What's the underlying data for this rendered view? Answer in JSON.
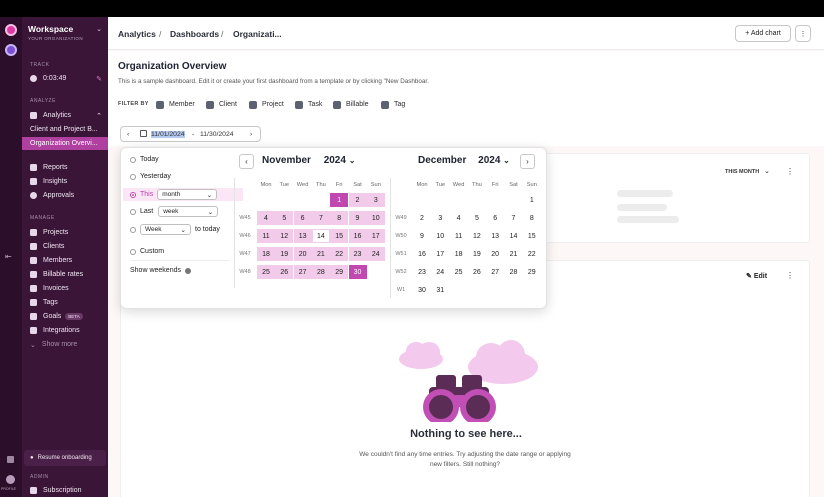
{
  "workspace": {
    "name": "Workspace",
    "subtitle": "YOUR ORGANIZATION",
    "rail_label": "PROFILE"
  },
  "sidebar": {
    "track_label": "TRACK",
    "timer": "0:03:49",
    "analyze_label": "ANALYZE",
    "analytics": "Analytics",
    "analytics_items": [
      "Client and Project B...",
      "Organization Overvi..."
    ],
    "analyze_items": [
      "Reports",
      "Insights",
      "Approvals"
    ],
    "manage_label": "MANAGE",
    "manage_items": [
      "Projects",
      "Clients",
      "Members",
      "Billable rates",
      "Invoices",
      "Tags",
      "Goals",
      "Integrations",
      "Show more"
    ],
    "goals_badge": "BETA",
    "resume": "Resume onboarding",
    "admin_label": "ADMIN",
    "subscription": "Subscription"
  },
  "header": {
    "breadcrumb": [
      "Analytics",
      "Dashboards",
      "Organizati..."
    ],
    "add_chart": "+ Add chart",
    "more": "⋮"
  },
  "page": {
    "title": "Organization Overview",
    "description": "This is a sample dashboard. Edit it or create your first dashboard from a template or by clicking \"New Dashboar.",
    "filter_by": "FILTER BY",
    "filters": [
      "Member",
      "Client",
      "Project",
      "Task",
      "Billable",
      "Tag"
    ]
  },
  "daterange": {
    "start": "11/01/2024",
    "separator": "-",
    "end": "11/30/2024"
  },
  "card1": {
    "period": "THIS MONTH"
  },
  "card2": {
    "edit": "Edit"
  },
  "empty": {
    "title": "Nothing to see here...",
    "subtitle": "We couldn't find any time entries. Try adjusting the date range or applying new filters. Still nothing?"
  },
  "picker": {
    "options": {
      "today": "Today",
      "yesterday": "Yesterday",
      "this": "This",
      "this_value": "month",
      "last": "Last",
      "last_value": "week",
      "period_value": "Week",
      "to_today": "to today",
      "custom": "Custom"
    },
    "show_weekends": "Show weekends",
    "show_weekends_on": true,
    "weekdays": [
      "Mon",
      "Tue",
      "Wed",
      "Thu",
      "Fri",
      "Sat",
      "Sun"
    ],
    "nov": {
      "month": "November",
      "year": "2024",
      "weeks": [
        {
          "wk": "",
          "days": [
            "",
            "",
            "",
            "",
            "1",
            "2",
            "3"
          ]
        },
        {
          "wk": "W45",
          "days": [
            "4",
            "5",
            "6",
            "7",
            "8",
            "9",
            "10"
          ]
        },
        {
          "wk": "W46",
          "days": [
            "11",
            "12",
            "13",
            "14",
            "15",
            "16",
            "17"
          ]
        },
        {
          "wk": "W47",
          "days": [
            "18",
            "19",
            "20",
            "21",
            "22",
            "23",
            "24"
          ]
        },
        {
          "wk": "W48",
          "days": [
            "25",
            "26",
            "27",
            "28",
            "29",
            "30",
            ""
          ]
        }
      ]
    },
    "dec": {
      "month": "December",
      "year": "2024",
      "weeks": [
        {
          "wk": "",
          "days": [
            "",
            "",
            "",
            "",
            "",
            "",
            "1"
          ]
        },
        {
          "wk": "W49",
          "days": [
            "2",
            "3",
            "4",
            "5",
            "6",
            "7",
            "8"
          ]
        },
        {
          "wk": "W50",
          "days": [
            "9",
            "10",
            "11",
            "12",
            "13",
            "14",
            "15"
          ]
        },
        {
          "wk": "W51",
          "days": [
            "16",
            "17",
            "18",
            "19",
            "20",
            "21",
            "22"
          ]
        },
        {
          "wk": "W52",
          "days": [
            "23",
            "24",
            "25",
            "26",
            "27",
            "28",
            "29"
          ]
        },
        {
          "wk": "W1",
          "days": [
            "30",
            "31",
            "",
            "",
            "",
            "",
            ""
          ]
        }
      ]
    },
    "selected_start": "1",
    "selected_end": "30",
    "today": "14"
  },
  "colors": {
    "accent": "#c040b0",
    "range": "#f1cbe9",
    "sidebar": "#3a1538",
    "active": "#b0409f"
  }
}
